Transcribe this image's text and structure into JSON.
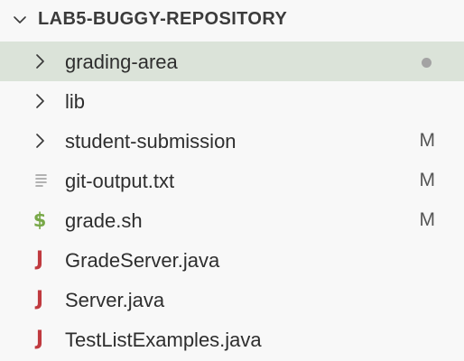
{
  "explorer": {
    "section_title": "LAB5-BUGGY-REPOSITORY",
    "items": [
      {
        "label": "grading-area",
        "kind": "folder",
        "badge": "",
        "selected": true,
        "modified_dot": true
      },
      {
        "label": "lib",
        "kind": "folder",
        "badge": "",
        "selected": false
      },
      {
        "label": "student-submission",
        "kind": "folder",
        "badge": "M",
        "selected": false
      },
      {
        "label": "git-output.txt",
        "kind": "text-file",
        "badge": "M",
        "selected": false
      },
      {
        "label": "grade.sh",
        "kind": "shell-file",
        "badge": "M",
        "selected": false
      },
      {
        "label": "GradeServer.java",
        "kind": "java-file",
        "badge": "",
        "selected": false
      },
      {
        "label": "Server.java",
        "kind": "java-file",
        "badge": "",
        "selected": false
      },
      {
        "label": "TestListExamples.java",
        "kind": "java-file",
        "badge": "",
        "selected": false
      }
    ],
    "icons": {
      "folder": "chevron-right-icon",
      "text-file": "lines-file-icon",
      "shell-file": "dollar-icon",
      "java-file": "java-icon"
    },
    "colors": {
      "selected_row": "#dbe3d9",
      "java_icon": "#c03a3f",
      "shell_icon": "#78a848",
      "dot": "#a3a3a3"
    }
  }
}
